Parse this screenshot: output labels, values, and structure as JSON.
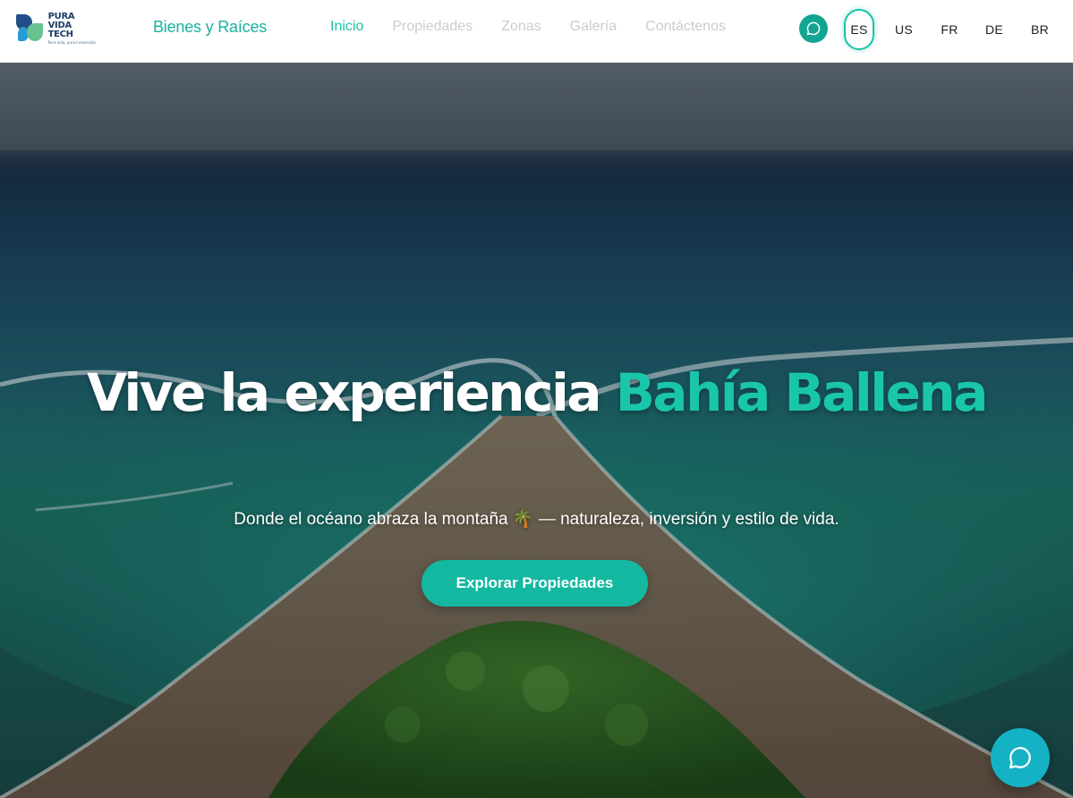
{
  "header": {
    "logo": {
      "line1": "PURA VIDA",
      "line2": "TECH",
      "tagline": "Pura vida, pura innovación"
    },
    "brand": "Bienes y Raíces",
    "nav": [
      {
        "label": "Inicio",
        "active": true
      },
      {
        "label": "Propiedades",
        "active": false
      },
      {
        "label": "Zonas",
        "active": false
      },
      {
        "label": "Galería",
        "active": false
      },
      {
        "label": "Contáctenos",
        "active": false
      }
    ],
    "chat_icon": "whatsapp-icon",
    "languages": [
      {
        "code": "ES",
        "active": true
      },
      {
        "code": "US",
        "active": false
      },
      {
        "code": "FR",
        "active": false
      },
      {
        "code": "DE",
        "active": false
      },
      {
        "code": "BR",
        "active": false
      }
    ]
  },
  "hero": {
    "title_prefix": "Vive la experiencia",
    "title_accent": "Bahía Ballena",
    "subtitle": "Donde el océano abraza la montaña 🌴 — naturaleza, inversión y estilo de vida.",
    "cta_label": "Explorar Propiedades"
  },
  "floating_chat": {
    "icon": "chat-bubble-icon"
  },
  "colors": {
    "accent": "#1cc2a8",
    "cta": "#14b8a0",
    "fab": "#14b2c4",
    "nav_inactive": "#c9cdd1"
  }
}
